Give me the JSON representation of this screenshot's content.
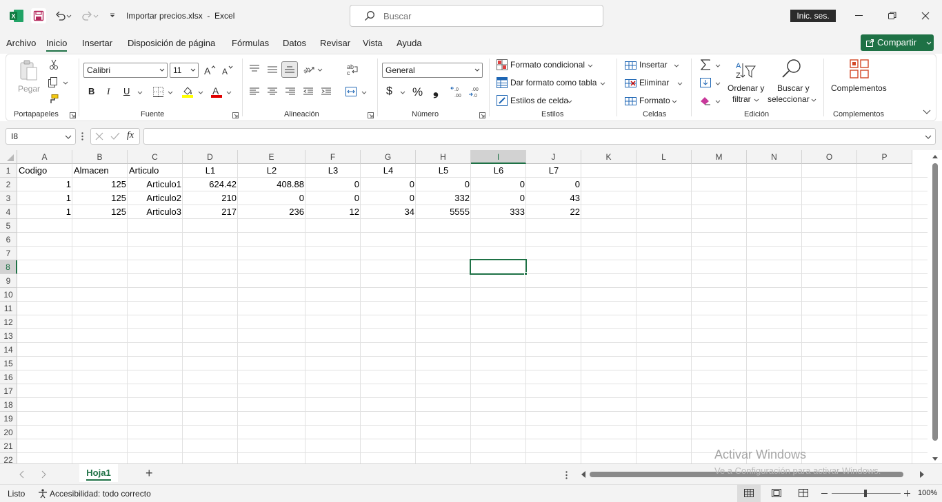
{
  "titlebar": {
    "filename": "Importar precios.xlsx",
    "separator": "-",
    "app": "Excel",
    "search_placeholder": "Buscar",
    "signin": "Inic. ses."
  },
  "menu": {
    "items": [
      "Archivo",
      "Inicio",
      "Insertar",
      "Disposición de página",
      "Fórmulas",
      "Datos",
      "Revisar",
      "Vista",
      "Ayuda"
    ],
    "share": "Compartir"
  },
  "ribbon": {
    "clipboard": {
      "paste": "Pegar",
      "label": "Portapapeles"
    },
    "font": {
      "name": "Calibri",
      "size": "11",
      "label": "Fuente",
      "bold": "B",
      "italic": "I",
      "underline": "U"
    },
    "alignment": {
      "label": "Alineación"
    },
    "number": {
      "format": "General",
      "label": "Número",
      "currency": "$",
      "percent": "%",
      "comma": "❟"
    },
    "styles": {
      "conditional": "Formato condicional",
      "as_table": "Dar formato como tabla",
      "cell_styles": "Estilos de celda",
      "label": "Estilos"
    },
    "cells": {
      "insert": "Insertar",
      "delete": "Eliminar",
      "format": "Formato",
      "label": "Celdas"
    },
    "editing": {
      "sort_1": "Ordenar y",
      "sort_2": "filtrar",
      "find_1": "Buscar y",
      "find_2": "seleccionar",
      "label": "Edición"
    },
    "addins": {
      "button": "Complementos",
      "label": "Complementos"
    }
  },
  "formula_bar": {
    "name_box": "I8",
    "fx": "fx",
    "formula": ""
  },
  "sheet": {
    "columns": [
      "A",
      "B",
      "C",
      "D",
      "E",
      "F",
      "G",
      "H",
      "I",
      "J",
      "K",
      "L",
      "M",
      "N",
      "O",
      "P"
    ],
    "rows": [
      "1",
      "2",
      "3",
      "4",
      "5",
      "6",
      "7",
      "8",
      "9",
      "10",
      "11",
      "12",
      "13",
      "14",
      "15",
      "16",
      "17",
      "18",
      "19",
      "20",
      "21",
      "22"
    ],
    "headers": [
      "Codigo",
      "Almacen",
      "Articulo",
      "L1",
      "L2",
      "L3",
      "L4",
      "L5",
      "L6",
      "L7"
    ],
    "data": [
      [
        "1",
        "125",
        "Articulo1",
        "624.42",
        "408.88",
        "0",
        "0",
        "0",
        "0",
        "0"
      ],
      [
        "1",
        "125",
        "Articulo2",
        "210",
        "0",
        "0",
        "0",
        "332",
        "0",
        "43"
      ],
      [
        "1",
        "125",
        "Articulo3",
        "217",
        "236",
        "12",
        "34",
        "5555",
        "333",
        "22"
      ]
    ],
    "selected_cell": "I8"
  },
  "tabs": {
    "sheet": "Hoja1",
    "add": "+"
  },
  "watermark": {
    "line1": "Activar Windows",
    "line2": "Ve a Configuración para activar Windows."
  },
  "status": {
    "ready": "Listo",
    "accessibility": "Accesibilidad: todo correcto",
    "zoom": "100%"
  }
}
